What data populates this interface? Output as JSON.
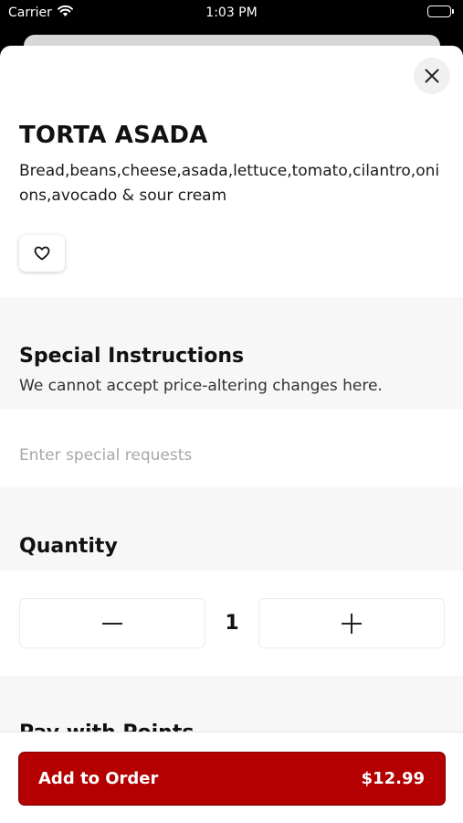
{
  "status_bar": {
    "carrier": "Carrier",
    "time": "1:03 PM",
    "battery_level": 1.0
  },
  "item": {
    "title": "TORTA ASADA",
    "description": "Bread,beans,cheese,asada,lettuce,tomato,cilantro,onions,avocado & sour cream",
    "favorite_icon": "heart-outline-icon",
    "close_icon": "close-icon"
  },
  "special_instructions": {
    "title": "Special Instructions",
    "subtitle": "We cannot accept price-altering changes here.",
    "placeholder": "Enter special requests",
    "value": ""
  },
  "quantity": {
    "title": "Quantity",
    "value": "1",
    "decrement_icon": "minus-icon",
    "increment_icon": "plus-icon"
  },
  "pay_with_points": {
    "title": "Pay with Points"
  },
  "order_button": {
    "label": "Add to Order",
    "price": "$12.99"
  },
  "colors": {
    "accent": "#b40000",
    "section_background": "#f7f7f7",
    "sheet_background": "#ffffff"
  }
}
